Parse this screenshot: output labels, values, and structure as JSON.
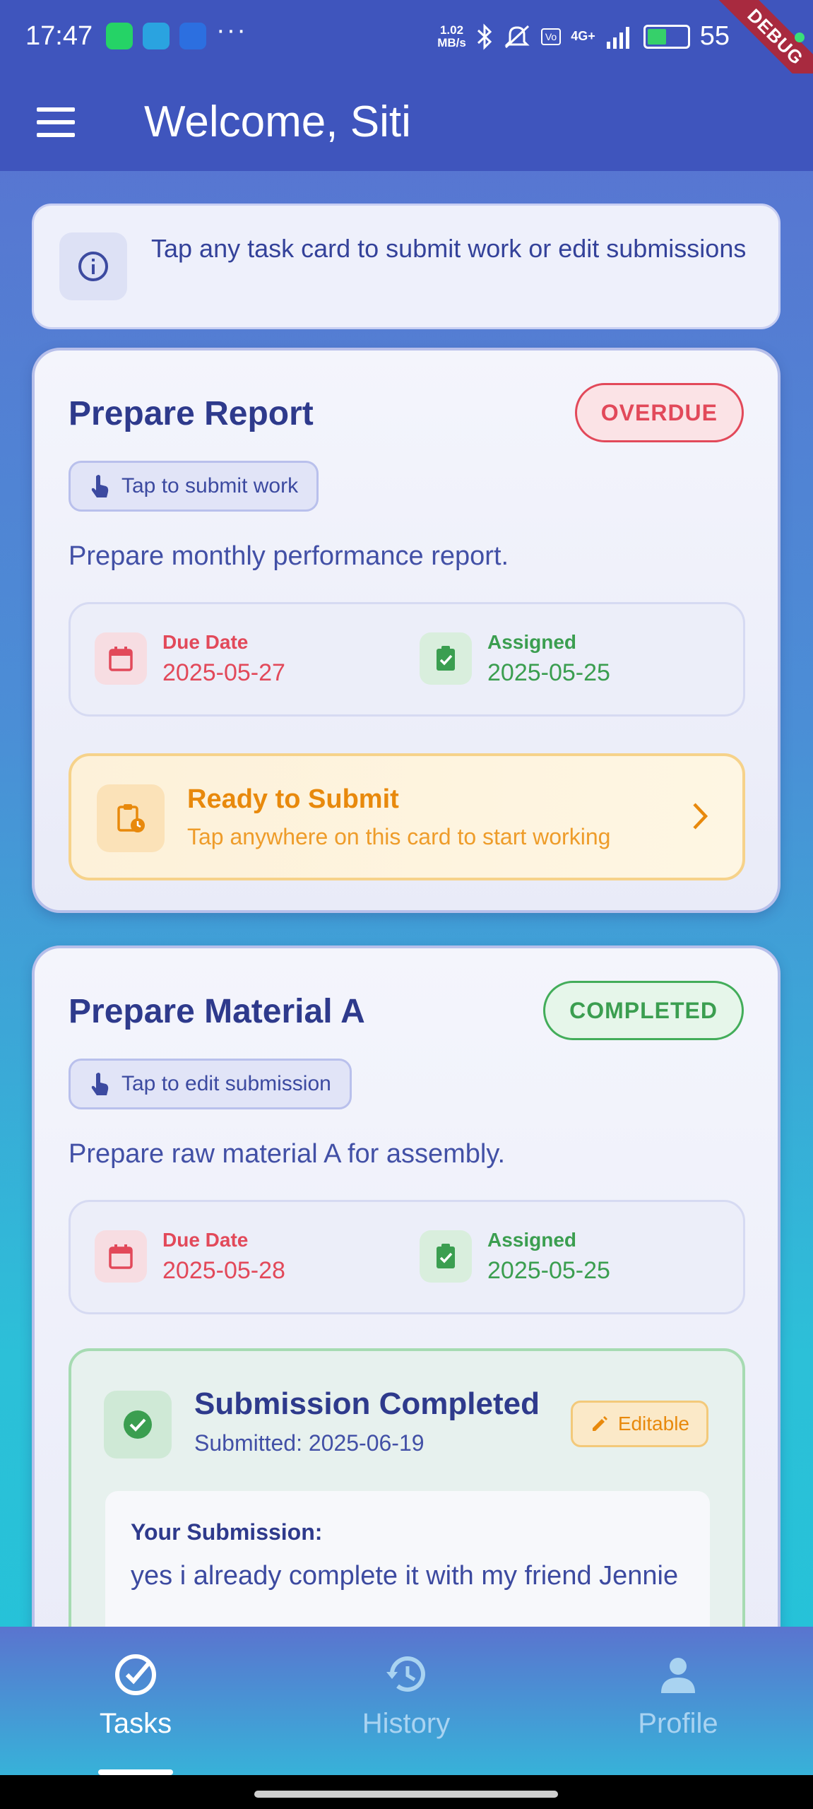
{
  "status_bar": {
    "time": "17:47",
    "dots": "···",
    "speed_value": "1.02",
    "speed_unit": "MB/s",
    "network": "4G+",
    "battery": "55",
    "debug": "DEBUG"
  },
  "app_bar": {
    "title": "Welcome, Siti"
  },
  "info_banner": {
    "message": "Tap any task card to submit work or edit submissions"
  },
  "tasks": [
    {
      "title": "Prepare Report",
      "status": "OVERDUE",
      "hint": "Tap to submit work",
      "description": "Prepare monthly performance report.",
      "due_label": "Due Date",
      "due_date": "2025-05-27",
      "assigned_label": "Assigned",
      "assigned_date": "2025-05-25",
      "action_title": "Ready to Submit",
      "action_subtitle": "Tap anywhere on this card to start working"
    },
    {
      "title": "Prepare Material A",
      "status": "COMPLETED",
      "hint": "Tap to edit submission",
      "description": "Prepare raw material A for assembly.",
      "due_label": "Due Date",
      "due_date": "2025-05-28",
      "assigned_label": "Assigned",
      "assigned_date": "2025-05-25",
      "submission_title": "Submission Completed",
      "submission_date": "Submitted: 2025-06-19",
      "editable_label": "Editable",
      "your_submission_label": "Your Submission:",
      "submission_text": "yes i already complete it with my friend Jennie"
    }
  ],
  "bottom_nav": [
    {
      "label": "Tasks",
      "icon": "check-circle-icon",
      "active": true
    },
    {
      "label": "History",
      "icon": "history-icon",
      "active": false
    },
    {
      "label": "Profile",
      "icon": "person-icon",
      "active": false
    }
  ],
  "colors": {
    "primary": "#3f55bd",
    "overdue": "#e2495a",
    "completed": "#43ad5a",
    "pending": "#e8890c"
  }
}
